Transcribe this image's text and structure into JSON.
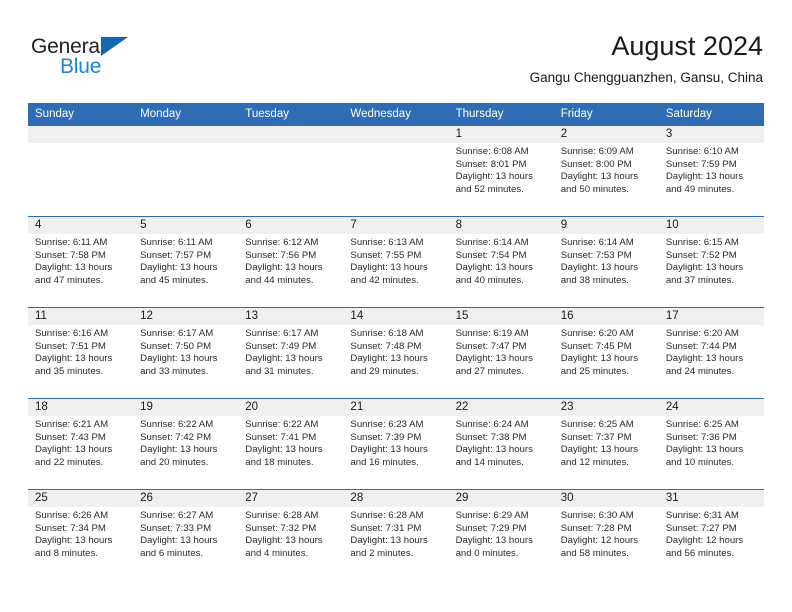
{
  "brand": {
    "name_top": "General",
    "name_bottom": "Blue",
    "triangle_icon": "triangle-icon",
    "color_top": "#231f20",
    "color_bottom": "#1e87d6",
    "accent": "#1268b3"
  },
  "header": {
    "title": "August 2024",
    "subtitle": "Gangu Chengguanzhen, Gansu, China"
  },
  "theme": {
    "header_blue": "#2e6db4",
    "daystrip_gray": "#f0f0f0",
    "text": "#1a1a1a"
  },
  "weekdays": [
    "Sunday",
    "Monday",
    "Tuesday",
    "Wednesday",
    "Thursday",
    "Friday",
    "Saturday"
  ],
  "weeks": [
    [
      {
        "day": "",
        "sunrise": "",
        "sunset": "",
        "daylight1": "",
        "daylight2": ""
      },
      {
        "day": "",
        "sunrise": "",
        "sunset": "",
        "daylight1": "",
        "daylight2": ""
      },
      {
        "day": "",
        "sunrise": "",
        "sunset": "",
        "daylight1": "",
        "daylight2": ""
      },
      {
        "day": "",
        "sunrise": "",
        "sunset": "",
        "daylight1": "",
        "daylight2": ""
      },
      {
        "day": "1",
        "sunrise": "Sunrise: 6:08 AM",
        "sunset": "Sunset: 8:01 PM",
        "daylight1": "Daylight: 13 hours",
        "daylight2": "and 52 minutes."
      },
      {
        "day": "2",
        "sunrise": "Sunrise: 6:09 AM",
        "sunset": "Sunset: 8:00 PM",
        "daylight1": "Daylight: 13 hours",
        "daylight2": "and 50 minutes."
      },
      {
        "day": "3",
        "sunrise": "Sunrise: 6:10 AM",
        "sunset": "Sunset: 7:59 PM",
        "daylight1": "Daylight: 13 hours",
        "daylight2": "and 49 minutes."
      }
    ],
    [
      {
        "day": "4",
        "sunrise": "Sunrise: 6:11 AM",
        "sunset": "Sunset: 7:58 PM",
        "daylight1": "Daylight: 13 hours",
        "daylight2": "and 47 minutes."
      },
      {
        "day": "5",
        "sunrise": "Sunrise: 6:11 AM",
        "sunset": "Sunset: 7:57 PM",
        "daylight1": "Daylight: 13 hours",
        "daylight2": "and 45 minutes."
      },
      {
        "day": "6",
        "sunrise": "Sunrise: 6:12 AM",
        "sunset": "Sunset: 7:56 PM",
        "daylight1": "Daylight: 13 hours",
        "daylight2": "and 44 minutes."
      },
      {
        "day": "7",
        "sunrise": "Sunrise: 6:13 AM",
        "sunset": "Sunset: 7:55 PM",
        "daylight1": "Daylight: 13 hours",
        "daylight2": "and 42 minutes."
      },
      {
        "day": "8",
        "sunrise": "Sunrise: 6:14 AM",
        "sunset": "Sunset: 7:54 PM",
        "daylight1": "Daylight: 13 hours",
        "daylight2": "and 40 minutes."
      },
      {
        "day": "9",
        "sunrise": "Sunrise: 6:14 AM",
        "sunset": "Sunset: 7:53 PM",
        "daylight1": "Daylight: 13 hours",
        "daylight2": "and 38 minutes."
      },
      {
        "day": "10",
        "sunrise": "Sunrise: 6:15 AM",
        "sunset": "Sunset: 7:52 PM",
        "daylight1": "Daylight: 13 hours",
        "daylight2": "and 37 minutes."
      }
    ],
    [
      {
        "day": "11",
        "sunrise": "Sunrise: 6:16 AM",
        "sunset": "Sunset: 7:51 PM",
        "daylight1": "Daylight: 13 hours",
        "daylight2": "and 35 minutes."
      },
      {
        "day": "12",
        "sunrise": "Sunrise: 6:17 AM",
        "sunset": "Sunset: 7:50 PM",
        "daylight1": "Daylight: 13 hours",
        "daylight2": "and 33 minutes."
      },
      {
        "day": "13",
        "sunrise": "Sunrise: 6:17 AM",
        "sunset": "Sunset: 7:49 PM",
        "daylight1": "Daylight: 13 hours",
        "daylight2": "and 31 minutes."
      },
      {
        "day": "14",
        "sunrise": "Sunrise: 6:18 AM",
        "sunset": "Sunset: 7:48 PM",
        "daylight1": "Daylight: 13 hours",
        "daylight2": "and 29 minutes."
      },
      {
        "day": "15",
        "sunrise": "Sunrise: 6:19 AM",
        "sunset": "Sunset: 7:47 PM",
        "daylight1": "Daylight: 13 hours",
        "daylight2": "and 27 minutes."
      },
      {
        "day": "16",
        "sunrise": "Sunrise: 6:20 AM",
        "sunset": "Sunset: 7:45 PM",
        "daylight1": "Daylight: 13 hours",
        "daylight2": "and 25 minutes."
      },
      {
        "day": "17",
        "sunrise": "Sunrise: 6:20 AM",
        "sunset": "Sunset: 7:44 PM",
        "daylight1": "Daylight: 13 hours",
        "daylight2": "and 24 minutes."
      }
    ],
    [
      {
        "day": "18",
        "sunrise": "Sunrise: 6:21 AM",
        "sunset": "Sunset: 7:43 PM",
        "daylight1": "Daylight: 13 hours",
        "daylight2": "and 22 minutes."
      },
      {
        "day": "19",
        "sunrise": "Sunrise: 6:22 AM",
        "sunset": "Sunset: 7:42 PM",
        "daylight1": "Daylight: 13 hours",
        "daylight2": "and 20 minutes."
      },
      {
        "day": "20",
        "sunrise": "Sunrise: 6:22 AM",
        "sunset": "Sunset: 7:41 PM",
        "daylight1": "Daylight: 13 hours",
        "daylight2": "and 18 minutes."
      },
      {
        "day": "21",
        "sunrise": "Sunrise: 6:23 AM",
        "sunset": "Sunset: 7:39 PM",
        "daylight1": "Daylight: 13 hours",
        "daylight2": "and 16 minutes."
      },
      {
        "day": "22",
        "sunrise": "Sunrise: 6:24 AM",
        "sunset": "Sunset: 7:38 PM",
        "daylight1": "Daylight: 13 hours",
        "daylight2": "and 14 minutes."
      },
      {
        "day": "23",
        "sunrise": "Sunrise: 6:25 AM",
        "sunset": "Sunset: 7:37 PM",
        "daylight1": "Daylight: 13 hours",
        "daylight2": "and 12 minutes."
      },
      {
        "day": "24",
        "sunrise": "Sunrise: 6:25 AM",
        "sunset": "Sunset: 7:36 PM",
        "daylight1": "Daylight: 13 hours",
        "daylight2": "and 10 minutes."
      }
    ],
    [
      {
        "day": "25",
        "sunrise": "Sunrise: 6:26 AM",
        "sunset": "Sunset: 7:34 PM",
        "daylight1": "Daylight: 13 hours",
        "daylight2": "and 8 minutes."
      },
      {
        "day": "26",
        "sunrise": "Sunrise: 6:27 AM",
        "sunset": "Sunset: 7:33 PM",
        "daylight1": "Daylight: 13 hours",
        "daylight2": "and 6 minutes."
      },
      {
        "day": "27",
        "sunrise": "Sunrise: 6:28 AM",
        "sunset": "Sunset: 7:32 PM",
        "daylight1": "Daylight: 13 hours",
        "daylight2": "and 4 minutes."
      },
      {
        "day": "28",
        "sunrise": "Sunrise: 6:28 AM",
        "sunset": "Sunset: 7:31 PM",
        "daylight1": "Daylight: 13 hours",
        "daylight2": "and 2 minutes."
      },
      {
        "day": "29",
        "sunrise": "Sunrise: 6:29 AM",
        "sunset": "Sunset: 7:29 PM",
        "daylight1": "Daylight: 13 hours",
        "daylight2": "and 0 minutes."
      },
      {
        "day": "30",
        "sunrise": "Sunrise: 6:30 AM",
        "sunset": "Sunset: 7:28 PM",
        "daylight1": "Daylight: 12 hours",
        "daylight2": "and 58 minutes."
      },
      {
        "day": "31",
        "sunrise": "Sunrise: 6:31 AM",
        "sunset": "Sunset: 7:27 PM",
        "daylight1": "Daylight: 12 hours",
        "daylight2": "and 56 minutes."
      }
    ]
  ]
}
